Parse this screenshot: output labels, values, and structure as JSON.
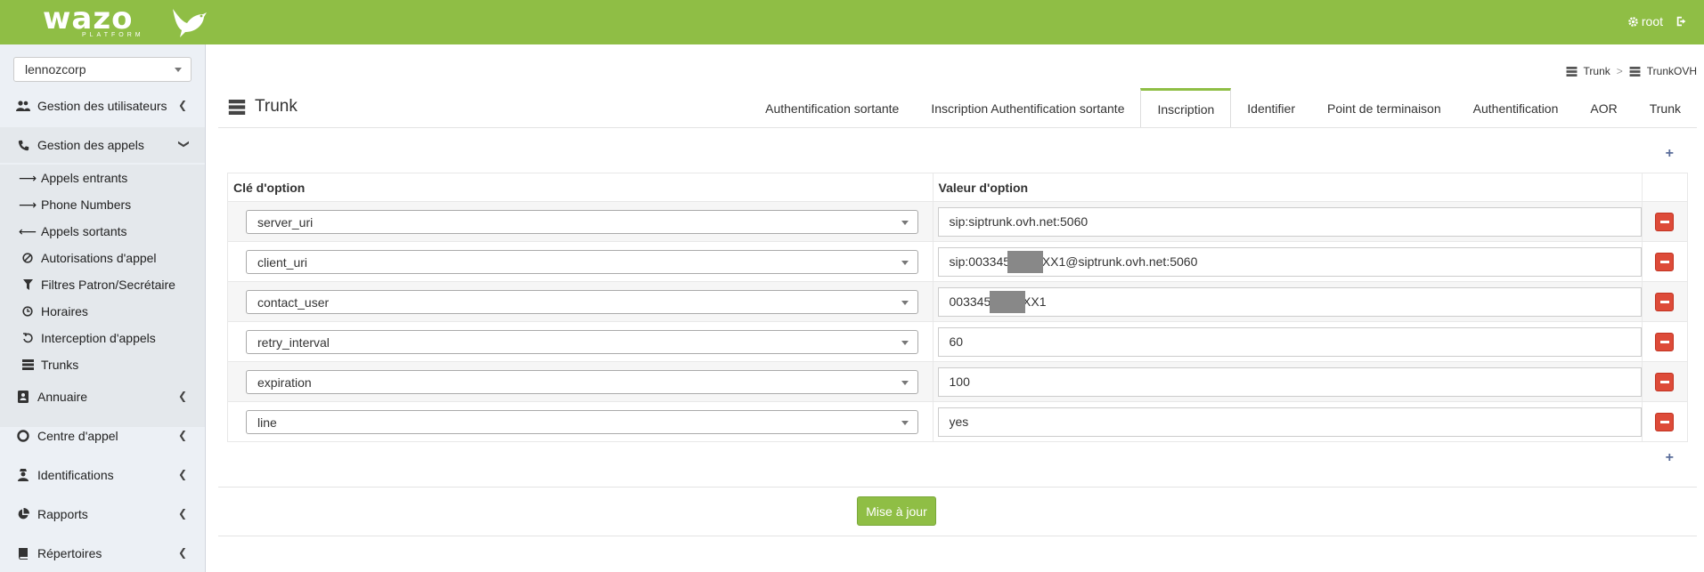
{
  "brand": {
    "name": "wazo",
    "sub": "PLATFORM"
  },
  "topbar": {
    "user": "root",
    "user_icon": "gear-icon",
    "logout_icon": "sign-out-icon"
  },
  "tenant": {
    "selected": "lennozcorp"
  },
  "sidebar": {
    "users": {
      "label": "Gestion des utilisateurs",
      "icon": "users-icon"
    },
    "calls": {
      "label": "Gestion des appels",
      "icon": "phone-icon"
    },
    "submenu": [
      {
        "label": "Appels entrants",
        "icon": "arrow-right-icon"
      },
      {
        "label": "Phone Numbers",
        "icon": "arrow-right-icon"
      },
      {
        "label": "Appels sortants",
        "icon": "arrow-left-icon"
      },
      {
        "label": "Autorisations d'appel",
        "icon": "ban-icon"
      },
      {
        "label": "Filtres Patron/Secrétaire",
        "icon": "filter-icon"
      },
      {
        "label": "Horaires",
        "icon": "clock-icon"
      },
      {
        "label": "Interception d'appels",
        "icon": "undo-icon"
      },
      {
        "label": "Trunks",
        "icon": "server-icon"
      }
    ],
    "directory": {
      "label": "Annuaire",
      "icon": "address-book-icon"
    },
    "callcenter": {
      "label": "Centre d'appel",
      "icon": "life-ring-icon"
    },
    "identities": {
      "label": "Identifications",
      "icon": "user-secret-icon"
    },
    "reports": {
      "label": "Rapports",
      "icon": "pie-chart-icon"
    },
    "repertories": {
      "label": "Répertoires",
      "icon": "book-icon"
    }
  },
  "breadcrumb": {
    "parent": "Trunk",
    "current": "TrunkOVH"
  },
  "page": {
    "title": "Trunk"
  },
  "tabs": [
    {
      "label": "Authentification sortante"
    },
    {
      "label": "Inscription Authentification sortante"
    },
    {
      "label": "Inscription"
    },
    {
      "label": "Identifier"
    },
    {
      "label": "Point de terminaison"
    },
    {
      "label": "Authentification"
    },
    {
      "label": "AOR"
    },
    {
      "label": "Trunk"
    }
  ],
  "active_tab": "Inscription",
  "table": {
    "col_key": "Clé d'option",
    "col_value": "Valeur d'option",
    "rows": [
      {
        "key": "server_uri",
        "value": "sip:siptrunk.ovh.net:5060"
      },
      {
        "key": "client_uri",
        "value": "sip:0033458XXXXX1@siptrunk.ovh.net:5060"
      },
      {
        "key": "contact_user",
        "value": "0033458XXXXX1"
      },
      {
        "key": "retry_interval",
        "value": "60"
      },
      {
        "key": "expiration",
        "value": "100"
      },
      {
        "key": "line",
        "value": "yes"
      }
    ]
  },
  "add_symbol": "+",
  "update_label": "Mise à jour",
  "colors": {
    "brand": "#8fbe45",
    "danger": "#dd4b39",
    "sidebar_bg": "#ecf0f5"
  }
}
